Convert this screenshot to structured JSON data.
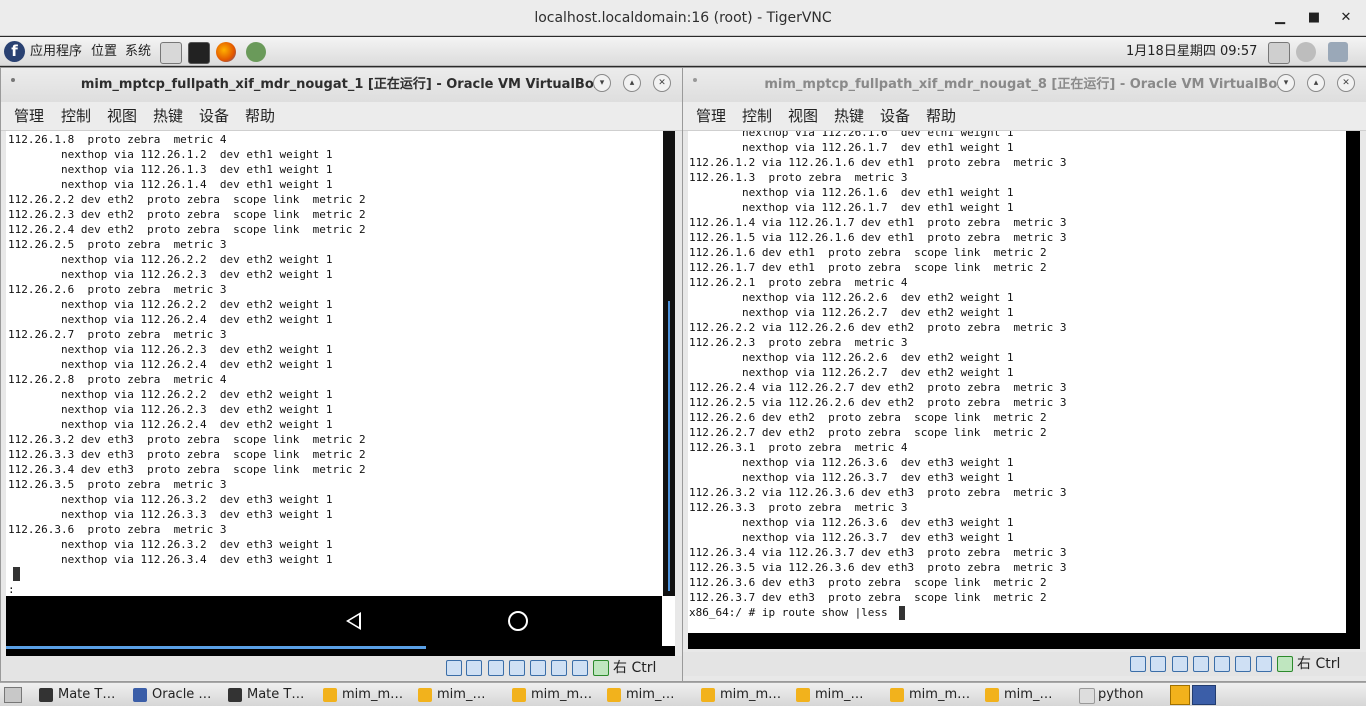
{
  "vnc": {
    "title": "localhost.localdomain:16 (root) - TigerVNC",
    "min": "▁",
    "max": "■",
    "close": "✕"
  },
  "panel": {
    "logo": "f",
    "menus": [
      "应用程序",
      "位置",
      "系统"
    ],
    "clock": "1月18日星期四 09:57",
    "launchers": [
      "text-editor-icon",
      "terminal-icon",
      "firefox-icon",
      "screenshot-icon"
    ]
  },
  "left_vm": {
    "title": "mim_mptcp_fullpath_xif_mdr_nougat_1 [正在运行] - Oracle VM VirtualBox",
    "menus": [
      "管理",
      "控制",
      "视图",
      "热键",
      "设备",
      "帮助"
    ],
    "terminal": "112.26.1.8  proto zebra  metric 4\n        nexthop via 112.26.1.2  dev eth1 weight 1\n        nexthop via 112.26.1.3  dev eth1 weight 1\n        nexthop via 112.26.1.4  dev eth1 weight 1\n112.26.2.2 dev eth2  proto zebra  scope link  metric 2\n112.26.2.3 dev eth2  proto zebra  scope link  metric 2\n112.26.2.4 dev eth2  proto zebra  scope link  metric 2\n112.26.2.5  proto zebra  metric 3\n        nexthop via 112.26.2.2  dev eth2 weight 1\n        nexthop via 112.26.2.3  dev eth2 weight 1\n112.26.2.6  proto zebra  metric 3\n        nexthop via 112.26.2.2  dev eth2 weight 1\n        nexthop via 112.26.2.4  dev eth2 weight 1\n112.26.2.7  proto zebra  metric 3\n        nexthop via 112.26.2.3  dev eth2 weight 1\n        nexthop via 112.26.2.4  dev eth2 weight 1\n112.26.2.8  proto zebra  metric 4\n        nexthop via 112.26.2.2  dev eth2 weight 1\n        nexthop via 112.26.2.3  dev eth2 weight 1\n        nexthop via 112.26.2.4  dev eth2 weight 1\n112.26.3.2 dev eth3  proto zebra  scope link  metric 2\n112.26.3.3 dev eth3  proto zebra  scope link  metric 2\n112.26.3.4 dev eth3  proto zebra  scope link  metric 2\n112.26.3.5  proto zebra  metric 3\n        nexthop via 112.26.3.2  dev eth3 weight 1\n        nexthop via 112.26.3.3  dev eth3 weight 1\n112.26.3.6  proto zebra  metric 3\n        nexthop via 112.26.3.2  dev eth3 weight 1\n        nexthop via 112.26.3.4  dev eth3 weight 1\n\n:",
    "host_key": "右 Ctrl"
  },
  "right_vm": {
    "title": "mim_mptcp_fullpath_xif_mdr_nougat_8 [正在运行] - Oracle VM VirtualBox",
    "menus": [
      "管理",
      "控制",
      "视图",
      "热键",
      "设备",
      "帮助"
    ],
    "terminal": "        nexthop via 112.26.1.6  dev eth1 weight 1\n        nexthop via 112.26.1.7  dev eth1 weight 1\n112.26.1.2 via 112.26.1.6 dev eth1  proto zebra  metric 3\n112.26.1.3  proto zebra  metric 3\n        nexthop via 112.26.1.6  dev eth1 weight 1\n        nexthop via 112.26.1.7  dev eth1 weight 1\n112.26.1.4 via 112.26.1.7 dev eth1  proto zebra  metric 3\n112.26.1.5 via 112.26.1.6 dev eth1  proto zebra  metric 3\n112.26.1.6 dev eth1  proto zebra  scope link  metric 2\n112.26.1.7 dev eth1  proto zebra  scope link  metric 2\n112.26.2.1  proto zebra  metric 4\n        nexthop via 112.26.2.6  dev eth2 weight 1\n        nexthop via 112.26.2.7  dev eth2 weight 1\n112.26.2.2 via 112.26.2.6 dev eth2  proto zebra  metric 3\n112.26.2.3  proto zebra  metric 3\n        nexthop via 112.26.2.6  dev eth2 weight 1\n        nexthop via 112.26.2.7  dev eth2 weight 1\n112.26.2.4 via 112.26.2.7 dev eth2  proto zebra  metric 3\n112.26.2.5 via 112.26.2.6 dev eth2  proto zebra  metric 3\n112.26.2.6 dev eth2  proto zebra  scope link  metric 2\n112.26.2.7 dev eth2  proto zebra  scope link  metric 2\n112.26.3.1  proto zebra  metric 4\n        nexthop via 112.26.3.6  dev eth3 weight 1\n        nexthop via 112.26.3.7  dev eth3 weight 1\n112.26.3.2 via 112.26.3.6 dev eth3  proto zebra  metric 3\n112.26.3.3  proto zebra  metric 3\n        nexthop via 112.26.3.6  dev eth3 weight 1\n        nexthop via 112.26.3.7  dev eth3 weight 1\n112.26.3.4 via 112.26.3.7 dev eth3  proto zebra  metric 3\n112.26.3.5 via 112.26.3.6 dev eth3  proto zebra  metric 3\n112.26.3.6 dev eth3  proto zebra  scope link  metric 2\n112.26.3.7 dev eth3  proto zebra  scope link  metric 2\nx86_64:/ # ip route show |less",
    "host_key": "右 Ctrl"
  },
  "taskbar": {
    "tasks": [
      "Mate T…",
      "Oracle …",
      "Mate T…",
      "mim_m…",
      "mim_…",
      "mim_m…",
      "mim_…",
      "mim_m…",
      "mim_…",
      "mim_m…",
      "mim_…",
      "python"
    ]
  },
  "colors": {
    "terminal_bg": "#ffffff",
    "android_nav": "#000000",
    "accent": "#3b6ea8"
  }
}
